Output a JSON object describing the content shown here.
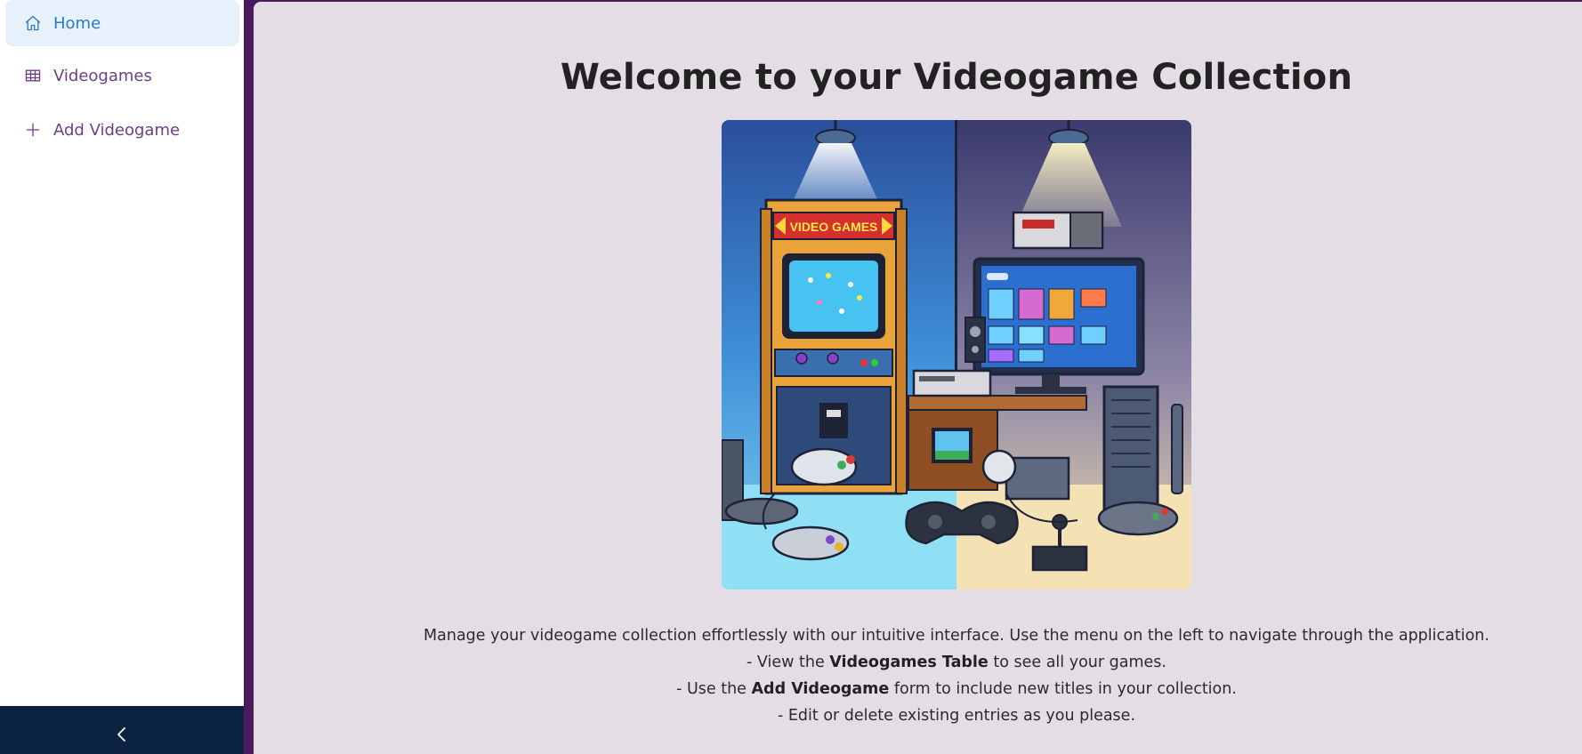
{
  "sidebar": {
    "items": [
      {
        "label": "Home",
        "icon": "home-icon",
        "active": true
      },
      {
        "label": "Videogames",
        "icon": "table-icon",
        "active": false
      },
      {
        "label": "Add Videogame",
        "icon": "plus-icon",
        "active": false
      }
    ],
    "collapse_icon": "chevron-left-icon"
  },
  "main": {
    "title": "Welcome to your Videogame Collection",
    "hero_image_alt": "Illustration of arcade cabinet and home consoles",
    "hero_sign_text": "VIDEO GAMES",
    "intro": "Manage your videogame collection effortlessly with our intuitive interface. Use the menu on the left to navigate through the application.",
    "bullets": [
      {
        "prefix": "- View the ",
        "bold": "Videogames Table",
        "suffix": " to see all your games."
      },
      {
        "prefix": "- Use the ",
        "bold": "Add Videogame",
        "suffix": " form to include new titles in your collection."
      },
      {
        "prefix": "- Edit or delete existing entries as you please.",
        "bold": "",
        "suffix": ""
      }
    ]
  },
  "colors": {
    "sidebar_bg": "#ffffff",
    "active_item_bg": "#e6f1fb",
    "active_item_text": "#2c7bc0",
    "item_text": "#6d3f84",
    "main_bg": "#e5dde6",
    "frame": "#4a1b5c",
    "collapse_bar_bg": "#0b2340"
  }
}
